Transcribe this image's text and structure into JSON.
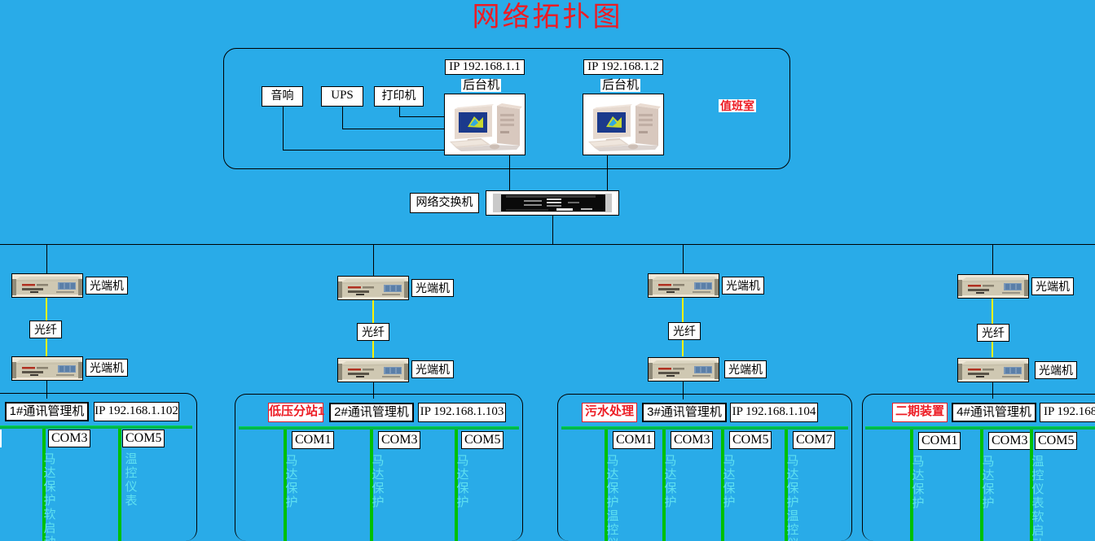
{
  "title": "网络拓扑图",
  "colors": {
    "background": "#29ABE8",
    "title": "#ED1C24",
    "fiber": "#FFF200",
    "bus": "#00C000",
    "device_text": "#5FE0F0",
    "label_bg": "#FFFFFF",
    "line": "#000000"
  },
  "control_room": {
    "area_label": "值班室",
    "peripherals": [
      {
        "label": "音响",
        "name": "audio-box"
      },
      {
        "label": "UPS",
        "name": "ups-box"
      },
      {
        "label": "打印机",
        "name": "printer-box"
      }
    ],
    "servers": [
      {
        "ip": "IP 192.168.1.1",
        "role": "后台机",
        "icon": "desktop-computer-icon"
      },
      {
        "ip": "IP 192.168.1.2",
        "role": "后台机",
        "icon": "desktop-computer-icon"
      }
    ]
  },
  "switch": {
    "label": "网络交换机",
    "icon": "rack-switch-icon"
  },
  "fiber_links": {
    "fiber_label": "光纤",
    "terminal_label": "光端机"
  },
  "branches": [
    {
      "top_terminal": "光端机",
      "fiber": "光纤",
      "bottom_terminal": "光端机",
      "station_name": "",
      "controller": "1#通讯管理机",
      "ip": "IP 192.168.1.102",
      "ports": [
        {
          "com": "",
          "devices": "",
          "clipped": true
        },
        {
          "com": "COM3",
          "devices": "马达保护 软启动"
        },
        {
          "com": "COM5",
          "devices": "温控仪表"
        }
      ]
    },
    {
      "top_terminal": "光端机",
      "fiber": "光纤",
      "bottom_terminal": "光端机",
      "station_name": "低压分站1",
      "controller": "2#通讯管理机",
      "ip": "IP 192.168.1.103",
      "ports": [
        {
          "com": "COM1",
          "devices": "马达保护"
        },
        {
          "com": "COM3",
          "devices": "马达保护"
        },
        {
          "com": "COM5",
          "devices": "马达保护"
        }
      ]
    },
    {
      "top_terminal": "光端机",
      "fiber": "光纤",
      "bottom_terminal": "光端机",
      "station_name": "污水处理",
      "controller": "3#通讯管理机",
      "ip": "IP 192.168.1.104",
      "ports": [
        {
          "com": "COM1",
          "devices": "马达保护温控仪"
        },
        {
          "com": "COM3",
          "devices": "马达保护"
        },
        {
          "com": "COM5",
          "devices": "马达保护"
        },
        {
          "com": "COM7",
          "devices": "马达保护温控仪"
        }
      ]
    },
    {
      "top_terminal": "光端机",
      "fiber": "光纤",
      "bottom_terminal": "光端机",
      "station_name": "二期装置",
      "controller": "4#通讯管理机",
      "ip": "IP 192.168.",
      "ports": [
        {
          "com": "COM1",
          "devices": "马达保护"
        },
        {
          "com": "COM3",
          "devices": "马达保护"
        },
        {
          "com": "COM5",
          "devices": "温控仪表软启动"
        }
      ]
    }
  ]
}
